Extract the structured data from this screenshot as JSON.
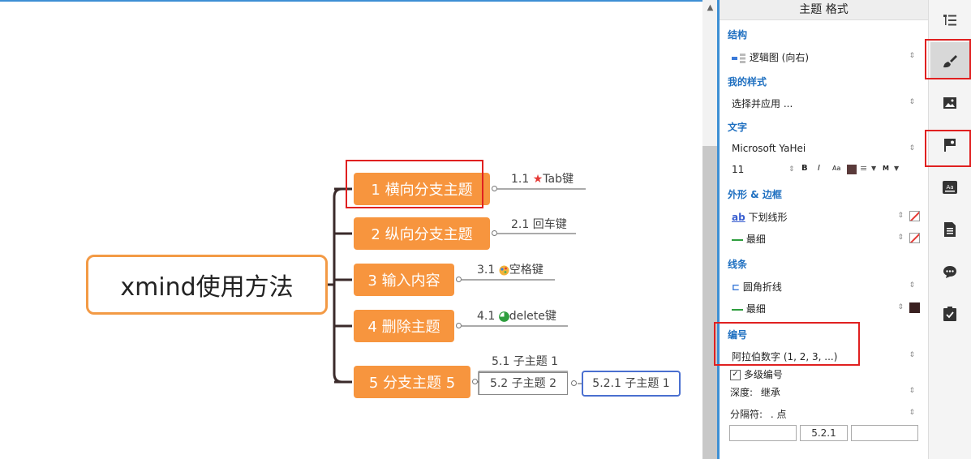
{
  "mindmap": {
    "root": "xmind使用方法",
    "branches": [
      {
        "label": "1 横向分支主题",
        "child": "1.1",
        "child_text": "Tab键",
        "child_icon": "star-icon"
      },
      {
        "label": "2 纵向分支主题",
        "child": "2.1",
        "child_text": "回车键",
        "child_icon": ""
      },
      {
        "label": "3 输入内容",
        "child": "3.1",
        "child_text": "空格键",
        "child_icon": "palette-icon"
      },
      {
        "label": "4 删除主题",
        "child": "4.1",
        "child_text": "delete键",
        "child_icon": "progress-icon"
      },
      {
        "label": "5 分支主题 5",
        "children": [
          "5.1 子主题 1",
          "5.2 子主题 2"
        ],
        "grandchild": "5.2.1 子主题 1"
      }
    ]
  },
  "panel": {
    "title": "主题 格式",
    "structure_label": "结构",
    "structure_value": "逻辑图 (向右)",
    "mystyle_label": "我的样式",
    "mystyle_value": "选择并应用 ...",
    "text_label": "文字",
    "font_name": "Microsoft YaHei",
    "font_size": "11",
    "bold": "B",
    "italic": "I",
    "case": "Aa",
    "more": "M",
    "shape_label": "外形 & 边框",
    "shape_value": "下划线形",
    "shape_icon_text": "ab",
    "border_value": "最细",
    "line_label": "线条",
    "line_style": "圆角折线",
    "line_width": "最细",
    "numbering_label": "编号",
    "numbering_value": "阿拉伯数字 (1, 2, 3, ...)",
    "multilevel_label": "多级编号",
    "depth_label": "深度:",
    "depth_value": "继承",
    "separator_label": "分隔符:",
    "separator_value": ". 点",
    "prefix": "",
    "preview": "5.2.1",
    "suffix": ""
  },
  "colors": {
    "accent": "#3d8fd4",
    "branch": "#f7953e",
    "root_border": "#f39a45",
    "highlight_red": "#e02020",
    "select_blue": "#4a6fd0",
    "text_color_swatch": "#5a3a3a",
    "line_color_swatch": "#3a2020"
  },
  "toolbar": [
    "outline-icon",
    "format-brush-icon",
    "image-icon",
    "marker-flag-icon",
    "text-style-icon",
    "notes-icon",
    "comment-icon",
    "task-icon"
  ]
}
